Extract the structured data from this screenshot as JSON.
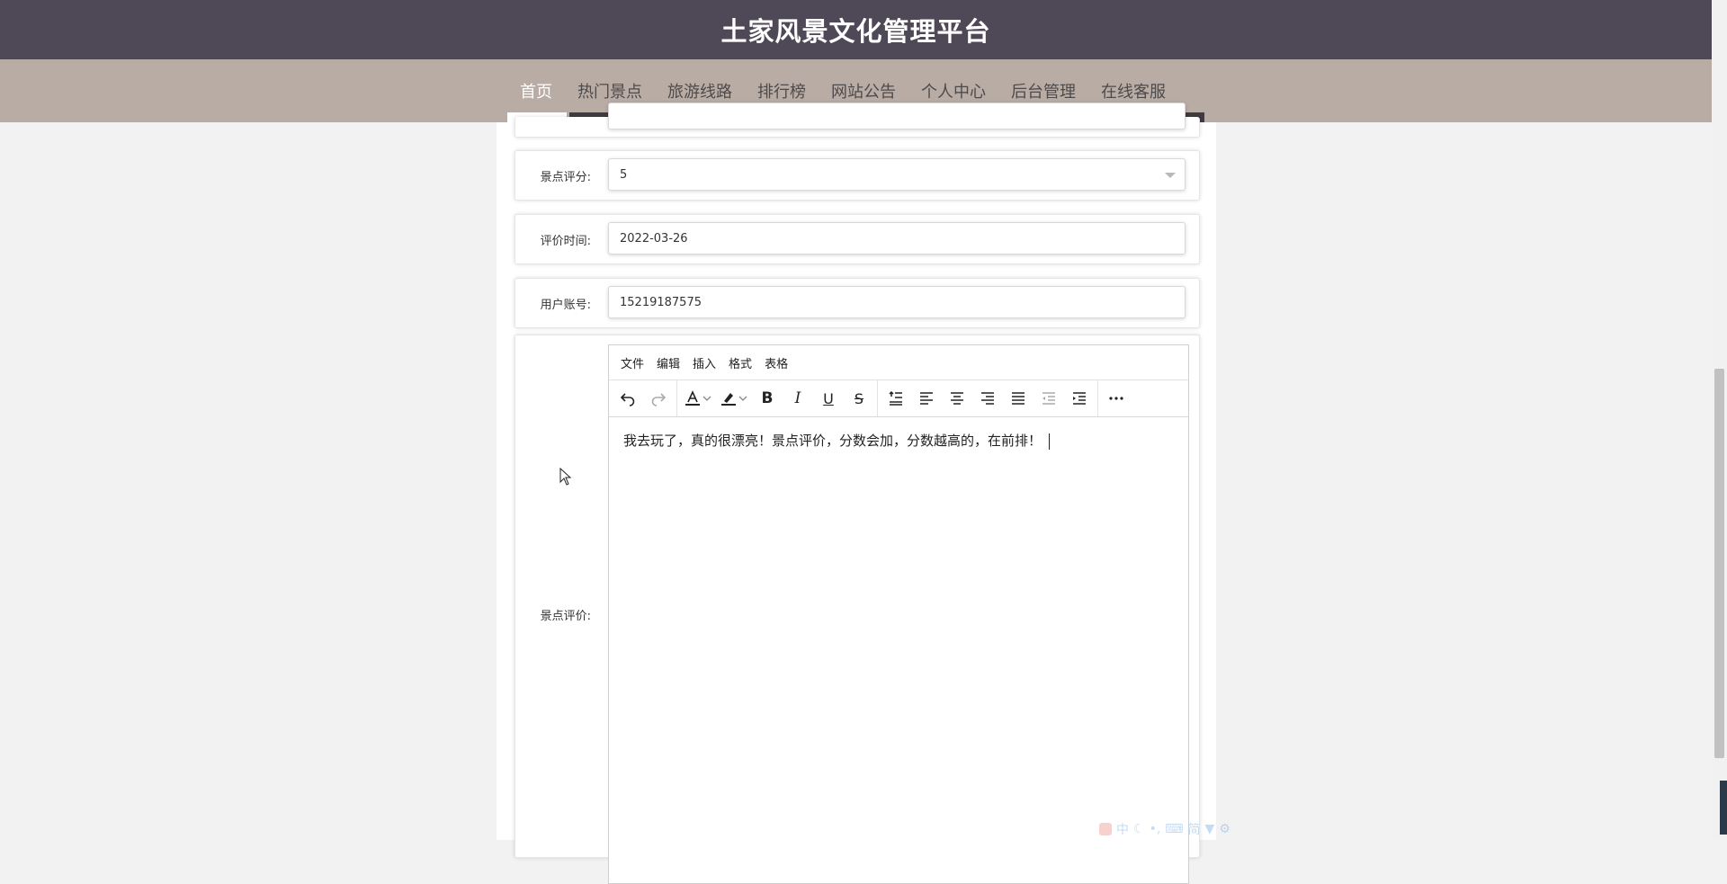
{
  "header": {
    "title": "土家风景文化管理平台"
  },
  "nav": {
    "items": [
      {
        "label": "首页",
        "active": true
      },
      {
        "label": "热门景点",
        "active": false
      },
      {
        "label": "旅游线路",
        "active": false
      },
      {
        "label": "排行榜",
        "active": false
      },
      {
        "label": "网站公告",
        "active": false
      },
      {
        "label": "个人中心",
        "active": false
      },
      {
        "label": "后台管理",
        "active": false
      },
      {
        "label": "在线客服",
        "active": false
      }
    ]
  },
  "form": {
    "rating": {
      "label": "景点评分:",
      "value": "5"
    },
    "time": {
      "label": "评价时间:",
      "value": "2022-03-26"
    },
    "account": {
      "label": "用户账号:",
      "value": "15219187575"
    },
    "review": {
      "label": "景点评价:",
      "menu": [
        "文件",
        "编辑",
        "插入",
        "格式",
        "表格"
      ],
      "content": "我去玩了，真的很漂亮！景点评价，分数会加，分数越高的，在前排！"
    }
  },
  "ime": {
    "glyphs": [
      "中",
      "简"
    ]
  },
  "colors": {
    "header_bg": "#4f4957",
    "nav_bg": "#b8aca5",
    "nav_active": "#ffffff"
  }
}
